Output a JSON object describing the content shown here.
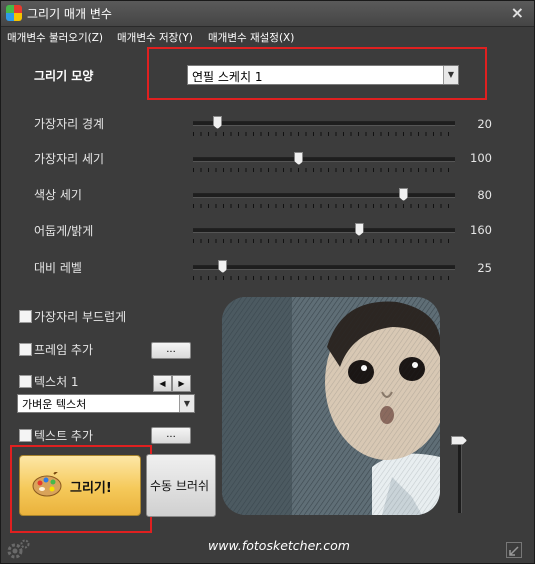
{
  "window": {
    "title": "그리기 매개 변수",
    "close_glyph": "×"
  },
  "menu": {
    "load": "매개변수 불러오기(Z)",
    "save": "매개변수 저장(Y)",
    "reset": "매개변수 재설정(X)"
  },
  "drawing_style": {
    "label": "그리기 모양",
    "selected": "연필 스케치 1"
  },
  "sliders": [
    {
      "label": "가장자리 경계",
      "value": "20",
      "fraction": 0.09
    },
    {
      "label": "가장자리 세기",
      "value": "100",
      "fraction": 0.4
    },
    {
      "label": "색상 세기",
      "value": "80",
      "fraction": 0.8
    },
    {
      "label": "어둡게/밝게",
      "value": "160",
      "fraction": 0.63
    },
    {
      "label": "대비 레벨",
      "value": "25",
      "fraction": 0.11
    }
  ],
  "options": {
    "smooth_edges": "가장자리 부드럽게",
    "add_frame": "프레임 추가",
    "texture": "텍스처 1",
    "texture_selected": "가벼운 텍스처",
    "add_text": "텍스트 추가",
    "browse_label": "..."
  },
  "buttons": {
    "draw": "그리기!",
    "manual_brush": "수동 브러쉬"
  },
  "footer": {
    "website": "www.fotosketcher.com"
  },
  "colors": {
    "window_bg": "#3c3c3c",
    "highlight": "#e02020",
    "draw_button": "#f5c95a"
  },
  "icons": {
    "app": "app-logo-icon",
    "close": "close-icon",
    "dropdown": "chevron-down-icon",
    "prev": "arrow-left-icon",
    "next": "arrow-right-icon",
    "palette": "palette-icon",
    "settings": "gear-icon",
    "resize": "resize-icon"
  }
}
